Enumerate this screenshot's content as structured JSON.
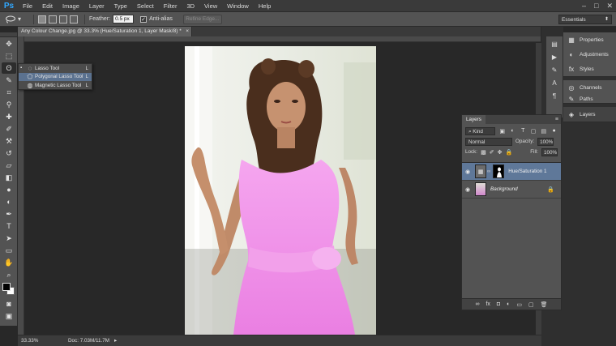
{
  "app": {
    "logo": "Ps"
  },
  "menu": [
    "File",
    "Edit",
    "Image",
    "Layer",
    "Type",
    "Select",
    "Filter",
    "3D",
    "View",
    "Window",
    "Help"
  ],
  "window_controls": {
    "minimize": "–",
    "restore": "□",
    "close": "✕"
  },
  "options_bar": {
    "feather_label": "Feather:",
    "feather_value": "0.5 px",
    "antialias_label": "Anti-alias",
    "antialias_checked": "✓",
    "refine_edge_label": "Refine Edge...",
    "workspace": "Essentials"
  },
  "document": {
    "tab_title": "Any Colour Change.jpg @ 33.3% (Hue/Saturation 1, Layer Mask/8) *",
    "close_glyph": "×",
    "zoom": "33.33%",
    "doc_info": "Doc: 7.03M/11.7M"
  },
  "flyout": {
    "items": [
      {
        "label": "Lasso Tool",
        "key": "L",
        "bullet": "▪"
      },
      {
        "label": "Polygonal Lasso Tool",
        "key": "L",
        "bullet": ""
      },
      {
        "label": "Magnetic Lasso Tool",
        "key": "L",
        "bullet": ""
      }
    ]
  },
  "right_panels": {
    "group1": [
      "Properties",
      "Adjustments",
      "Styles"
    ],
    "group2": [
      "Channels",
      "Paths"
    ],
    "group3": [
      "Layers"
    ]
  },
  "layers_panel": {
    "tab": "Layers",
    "kind_label": "Kind",
    "blend_mode": "Normal",
    "opacity_label": "Opacity:",
    "opacity_value": "100%",
    "lock_label": "Lock:",
    "fill_label": "Fill:",
    "fill_value": "100%",
    "layers": [
      {
        "name": "Hue/Saturation 1",
        "selected": true
      },
      {
        "name": "Background",
        "selected": false
      }
    ]
  },
  "colors": {
    "accent_selected": "#5f7899",
    "dress_pink": "#f08ee8",
    "foreground": "#000000",
    "background": "#ffffff"
  }
}
